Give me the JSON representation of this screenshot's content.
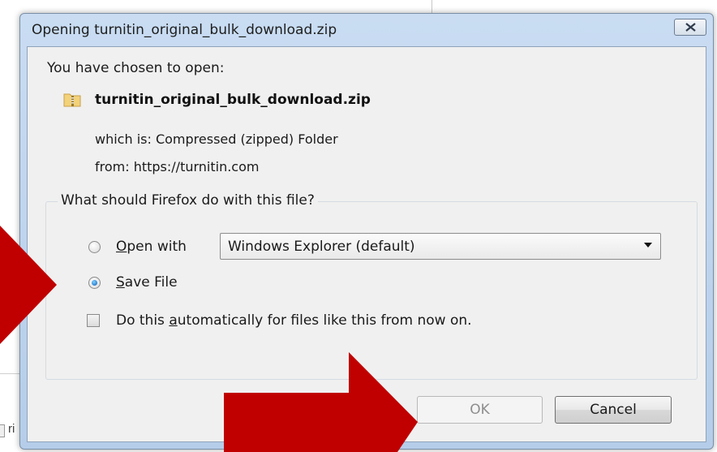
{
  "background": {
    "fragment_text": "ri"
  },
  "dialog": {
    "title": "Opening turnitin_original_bulk_download.zip",
    "prompt": "You have chosen to open:",
    "file_name": "turnitin_original_bulk_download.zip",
    "file_type": "which is: Compressed (zipped) Folder",
    "file_from": "from: https://turnitin.com",
    "group_title": "What should Firefox do with this file?",
    "open_with": {
      "label_mnemonic": "O",
      "label_rest": "pen with",
      "selected": false,
      "app": "Windows Explorer (default)"
    },
    "save_file": {
      "label_mnemonic": "S",
      "label_rest": "ave File",
      "selected": true
    },
    "auto": {
      "label_before": "Do this ",
      "label_mnemonic": "a",
      "label_after": "utomatically for files like this from now on.",
      "checked": false
    },
    "ok_label": "OK",
    "cancel_label": "Cancel"
  },
  "colors": {
    "annotation_arrow": "#c00000",
    "title_bar": "#c9dcf2",
    "client_bg": "#f0f0f0"
  },
  "icons": {
    "close": "close-x-icon",
    "file": "zip-folder-icon"
  }
}
